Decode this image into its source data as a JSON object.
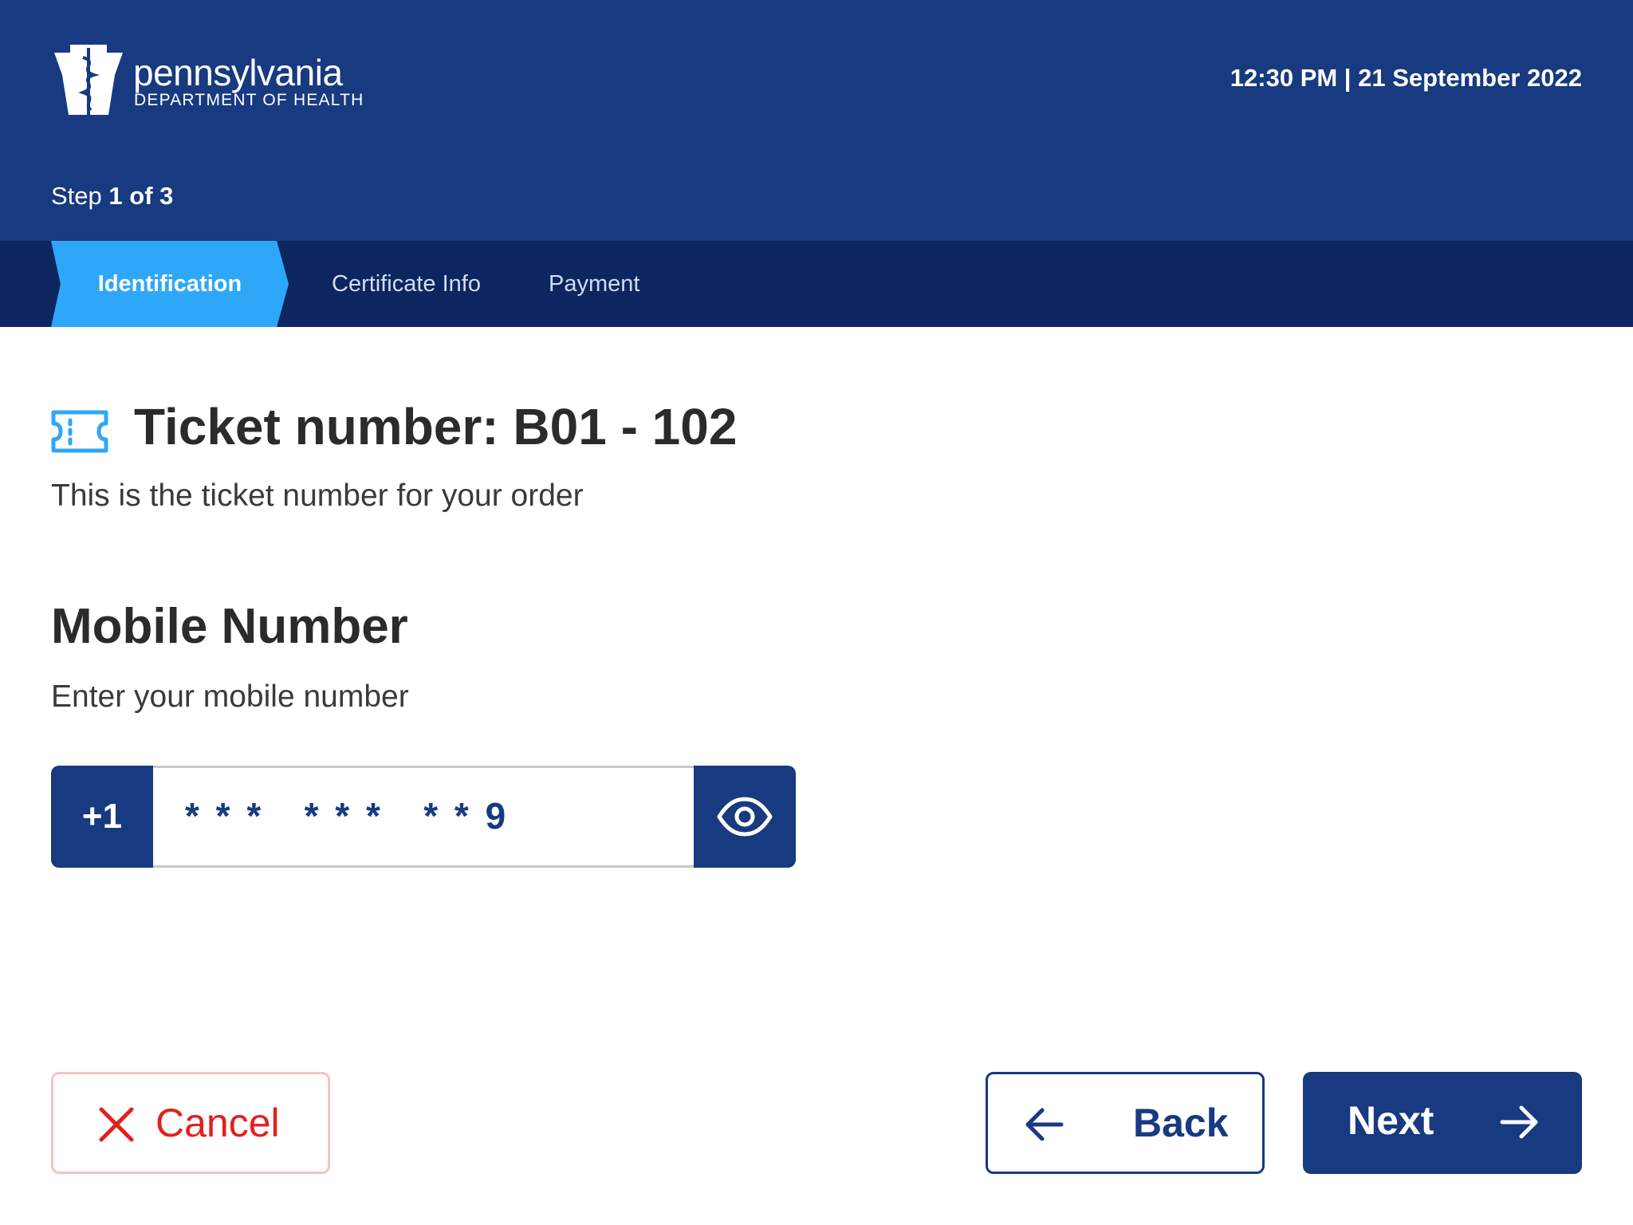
{
  "header": {
    "logo": {
      "name": "pennsylvania",
      "subtitle": "DEPARTMENT OF HEALTH",
      "icon": "keystone-icon"
    },
    "datetime": "12:30 PM | 21 September 2022",
    "step": {
      "prefix": "Step",
      "current": "1 of 3"
    }
  },
  "progress_tabs": [
    {
      "label": "Identification",
      "active": true
    },
    {
      "label": "Certificate Info",
      "active": false
    },
    {
      "label": "Payment",
      "active": false
    }
  ],
  "ticket": {
    "icon": "ticket-icon",
    "title": "Ticket number: B01 - 102",
    "description": "This is the ticket number for your order"
  },
  "mobile": {
    "title": "Mobile Number",
    "description": "Enter your mobile number",
    "country_code": "+1",
    "value_masked": "* * *   * * *   * * 9",
    "toggle_icon": "eye-icon"
  },
  "actions": {
    "cancel_label": "Cancel",
    "back_label": "Back",
    "next_label": "Next"
  },
  "colors": {
    "header_bg": "#173a80",
    "nav_bg": "#0d2660",
    "active_tab": "#2ea7f9",
    "primary": "#173a80",
    "danger": "#e3201b"
  }
}
